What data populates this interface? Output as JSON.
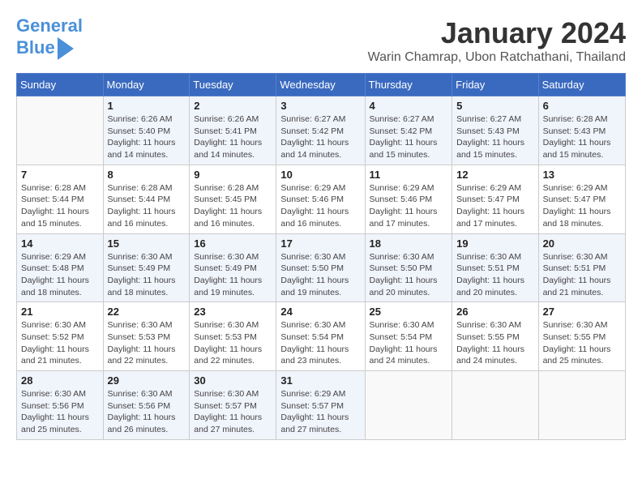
{
  "header": {
    "logo_line1": "General",
    "logo_line2": "Blue",
    "month_title": "January 2024",
    "location": "Warin Chamrap, Ubon Ratchathani, Thailand"
  },
  "weekdays": [
    "Sunday",
    "Monday",
    "Tuesday",
    "Wednesday",
    "Thursday",
    "Friday",
    "Saturday"
  ],
  "weeks": [
    [
      {
        "day": "",
        "info": ""
      },
      {
        "day": "1",
        "info": "Sunrise: 6:26 AM\nSunset: 5:40 PM\nDaylight: 11 hours\nand 14 minutes."
      },
      {
        "day": "2",
        "info": "Sunrise: 6:26 AM\nSunset: 5:41 PM\nDaylight: 11 hours\nand 14 minutes."
      },
      {
        "day": "3",
        "info": "Sunrise: 6:27 AM\nSunset: 5:42 PM\nDaylight: 11 hours\nand 14 minutes."
      },
      {
        "day": "4",
        "info": "Sunrise: 6:27 AM\nSunset: 5:42 PM\nDaylight: 11 hours\nand 15 minutes."
      },
      {
        "day": "5",
        "info": "Sunrise: 6:27 AM\nSunset: 5:43 PM\nDaylight: 11 hours\nand 15 minutes."
      },
      {
        "day": "6",
        "info": "Sunrise: 6:28 AM\nSunset: 5:43 PM\nDaylight: 11 hours\nand 15 minutes."
      }
    ],
    [
      {
        "day": "7",
        "info": "Sunrise: 6:28 AM\nSunset: 5:44 PM\nDaylight: 11 hours\nand 15 minutes."
      },
      {
        "day": "8",
        "info": "Sunrise: 6:28 AM\nSunset: 5:44 PM\nDaylight: 11 hours\nand 16 minutes."
      },
      {
        "day": "9",
        "info": "Sunrise: 6:28 AM\nSunset: 5:45 PM\nDaylight: 11 hours\nand 16 minutes."
      },
      {
        "day": "10",
        "info": "Sunrise: 6:29 AM\nSunset: 5:46 PM\nDaylight: 11 hours\nand 16 minutes."
      },
      {
        "day": "11",
        "info": "Sunrise: 6:29 AM\nSunset: 5:46 PM\nDaylight: 11 hours\nand 17 minutes."
      },
      {
        "day": "12",
        "info": "Sunrise: 6:29 AM\nSunset: 5:47 PM\nDaylight: 11 hours\nand 17 minutes."
      },
      {
        "day": "13",
        "info": "Sunrise: 6:29 AM\nSunset: 5:47 PM\nDaylight: 11 hours\nand 18 minutes."
      }
    ],
    [
      {
        "day": "14",
        "info": "Sunrise: 6:29 AM\nSunset: 5:48 PM\nDaylight: 11 hours\nand 18 minutes."
      },
      {
        "day": "15",
        "info": "Sunrise: 6:30 AM\nSunset: 5:49 PM\nDaylight: 11 hours\nand 18 minutes."
      },
      {
        "day": "16",
        "info": "Sunrise: 6:30 AM\nSunset: 5:49 PM\nDaylight: 11 hours\nand 19 minutes."
      },
      {
        "day": "17",
        "info": "Sunrise: 6:30 AM\nSunset: 5:50 PM\nDaylight: 11 hours\nand 19 minutes."
      },
      {
        "day": "18",
        "info": "Sunrise: 6:30 AM\nSunset: 5:50 PM\nDaylight: 11 hours\nand 20 minutes."
      },
      {
        "day": "19",
        "info": "Sunrise: 6:30 AM\nSunset: 5:51 PM\nDaylight: 11 hours\nand 20 minutes."
      },
      {
        "day": "20",
        "info": "Sunrise: 6:30 AM\nSunset: 5:51 PM\nDaylight: 11 hours\nand 21 minutes."
      }
    ],
    [
      {
        "day": "21",
        "info": "Sunrise: 6:30 AM\nSunset: 5:52 PM\nDaylight: 11 hours\nand 21 minutes."
      },
      {
        "day": "22",
        "info": "Sunrise: 6:30 AM\nSunset: 5:53 PM\nDaylight: 11 hours\nand 22 minutes."
      },
      {
        "day": "23",
        "info": "Sunrise: 6:30 AM\nSunset: 5:53 PM\nDaylight: 11 hours\nand 22 minutes."
      },
      {
        "day": "24",
        "info": "Sunrise: 6:30 AM\nSunset: 5:54 PM\nDaylight: 11 hours\nand 23 minutes."
      },
      {
        "day": "25",
        "info": "Sunrise: 6:30 AM\nSunset: 5:54 PM\nDaylight: 11 hours\nand 24 minutes."
      },
      {
        "day": "26",
        "info": "Sunrise: 6:30 AM\nSunset: 5:55 PM\nDaylight: 11 hours\nand 24 minutes."
      },
      {
        "day": "27",
        "info": "Sunrise: 6:30 AM\nSunset: 5:55 PM\nDaylight: 11 hours\nand 25 minutes."
      }
    ],
    [
      {
        "day": "28",
        "info": "Sunrise: 6:30 AM\nSunset: 5:56 PM\nDaylight: 11 hours\nand 25 minutes."
      },
      {
        "day": "29",
        "info": "Sunrise: 6:30 AM\nSunset: 5:56 PM\nDaylight: 11 hours\nand 26 minutes."
      },
      {
        "day": "30",
        "info": "Sunrise: 6:30 AM\nSunset: 5:57 PM\nDaylight: 11 hours\nand 27 minutes."
      },
      {
        "day": "31",
        "info": "Sunrise: 6:29 AM\nSunset: 5:57 PM\nDaylight: 11 hours\nand 27 minutes."
      },
      {
        "day": "",
        "info": ""
      },
      {
        "day": "",
        "info": ""
      },
      {
        "day": "",
        "info": ""
      }
    ]
  ]
}
